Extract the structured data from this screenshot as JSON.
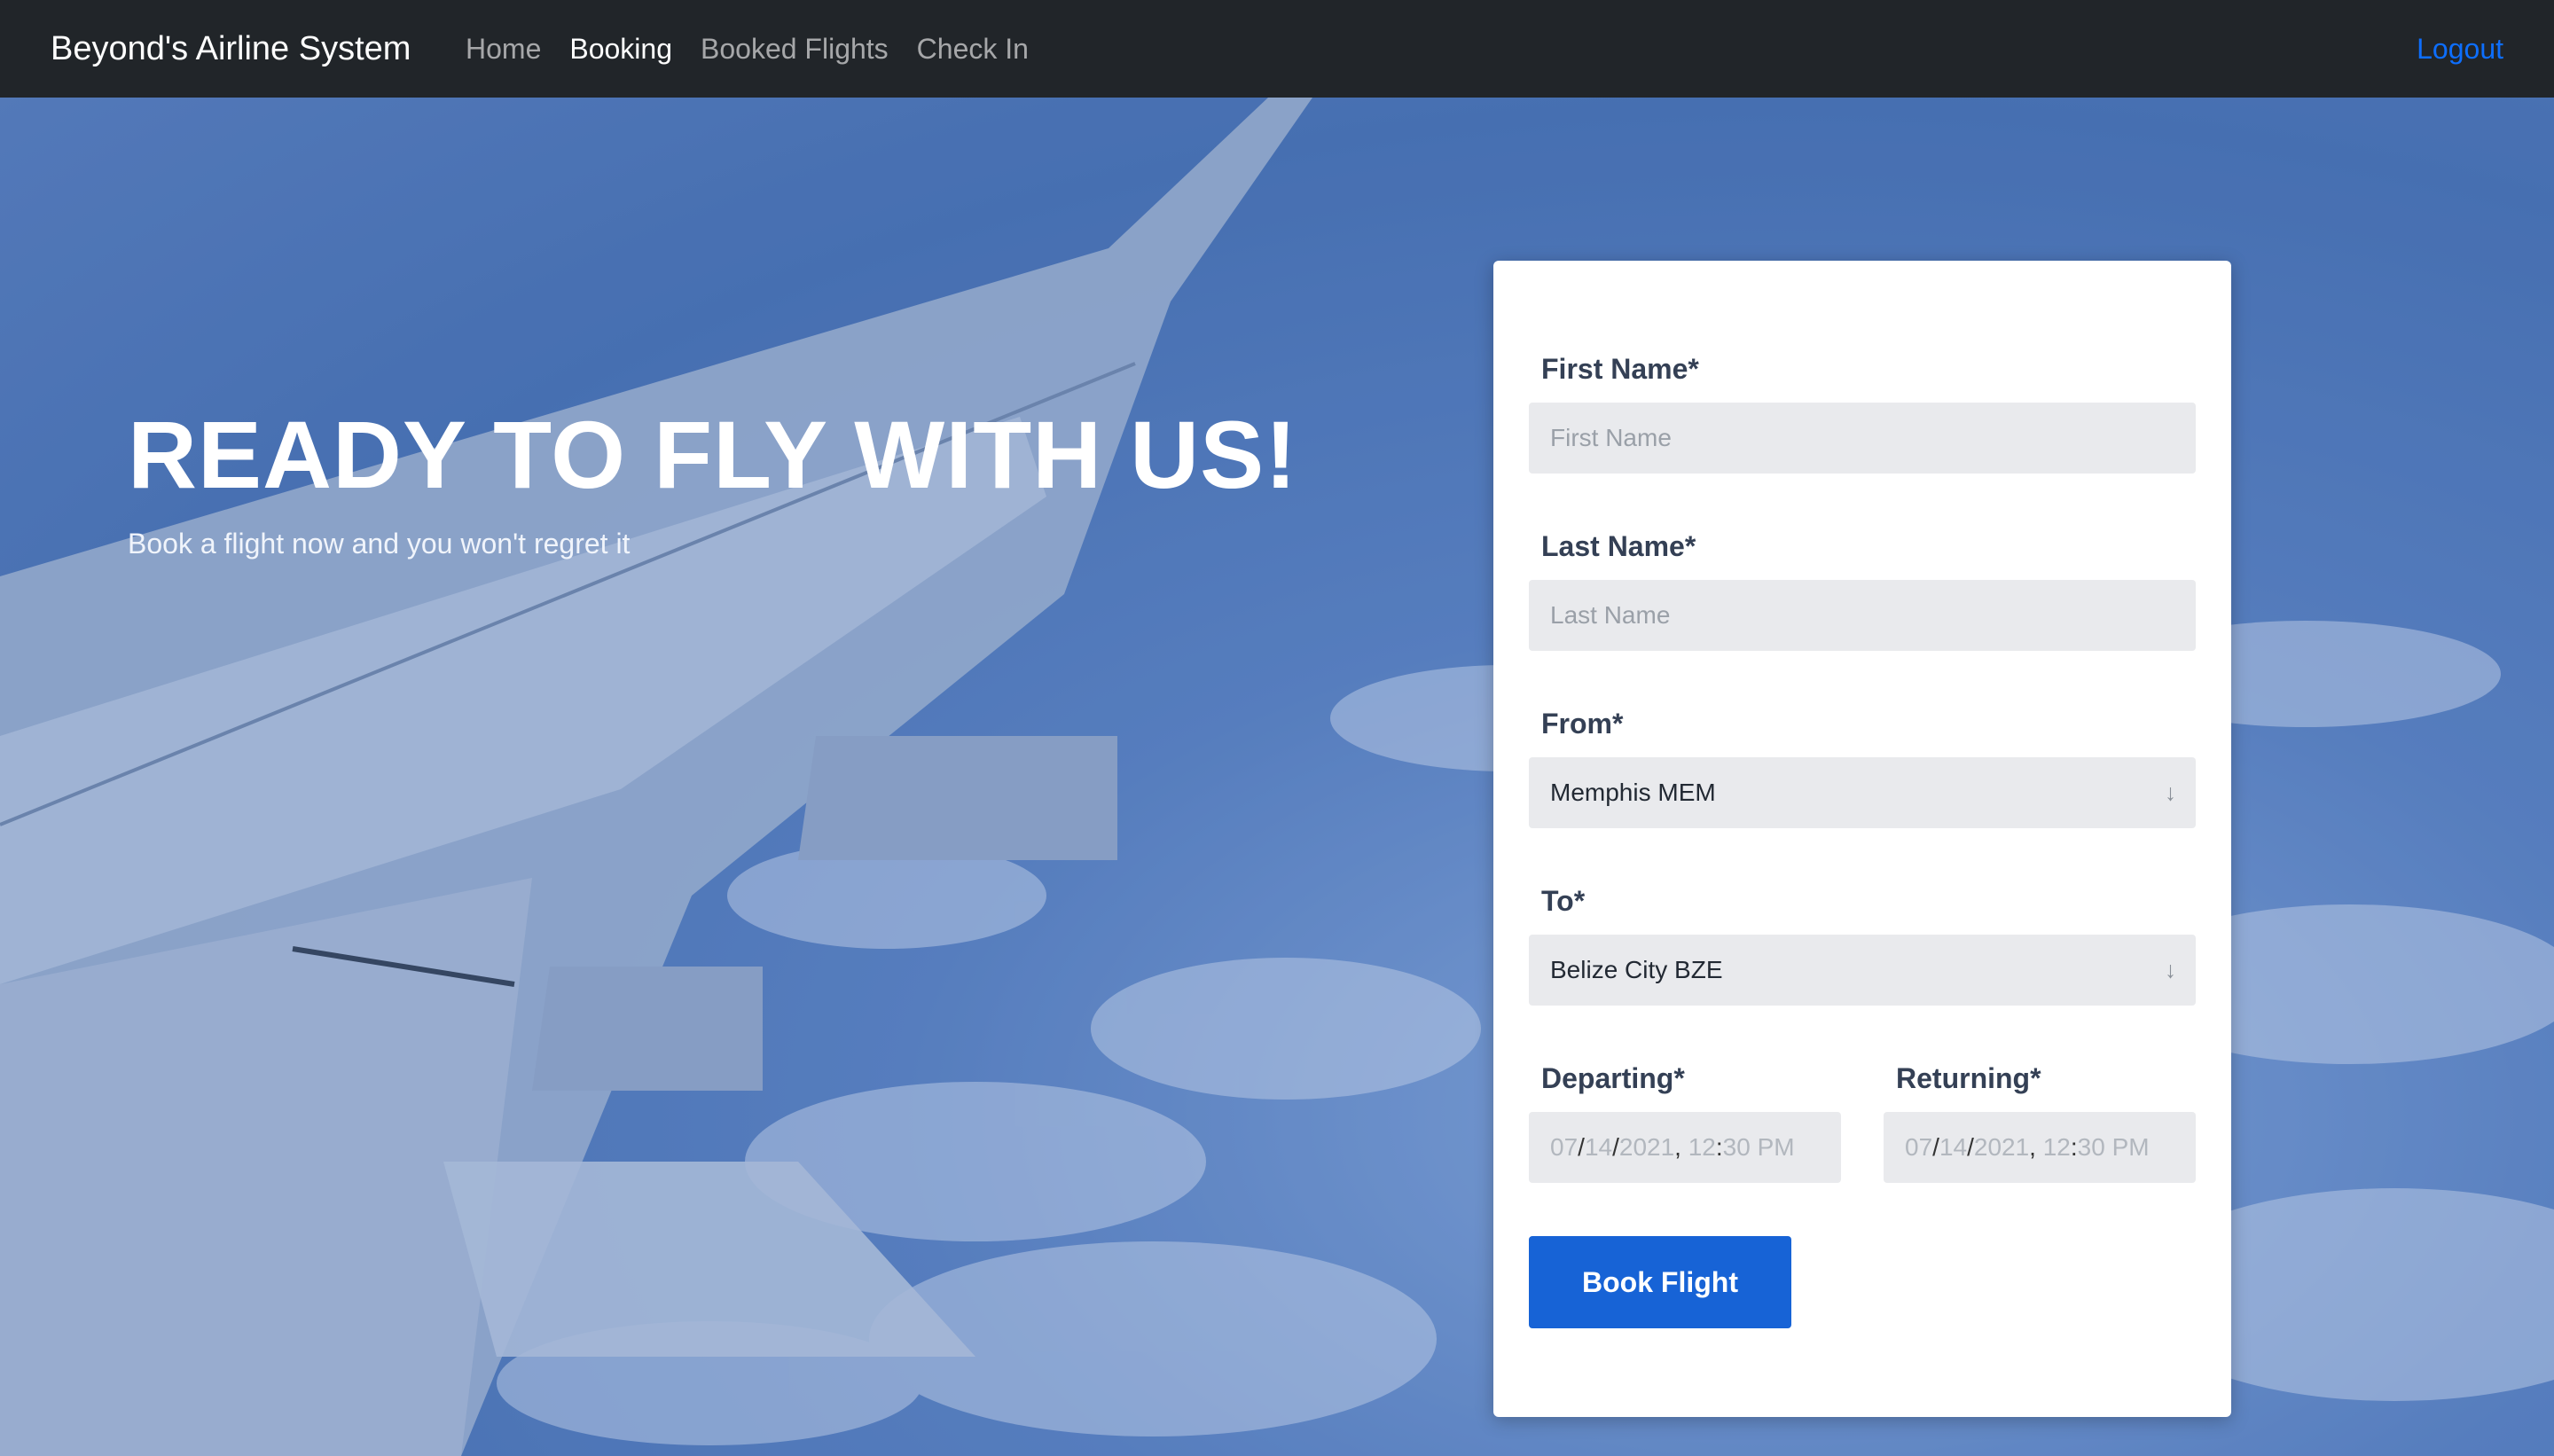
{
  "nav": {
    "brand": "Beyond's Airline System",
    "links": [
      "Home",
      "Booking",
      "Booked Flights",
      "Check In"
    ],
    "active": "Booking",
    "logout": "Logout"
  },
  "hero": {
    "headline": "READY TO FLY WITH US!",
    "subhead": "Book a flight now and you won't regret it"
  },
  "form": {
    "first_name": {
      "label": "First Name*",
      "placeholder": "First Name"
    },
    "last_name": {
      "label": "Last Name*",
      "placeholder": "Last Name"
    },
    "from": {
      "label": "From*",
      "value": "Memphis MEM"
    },
    "to": {
      "label": "To*",
      "value": "Belize City BZE"
    },
    "departing": {
      "label": "Departing*",
      "month": "07",
      "day": "14",
      "year": "2021",
      "hour": "12",
      "minute": "30",
      "ampm": "PM"
    },
    "returning": {
      "label": "Returning*",
      "month": "07",
      "day": "14",
      "year": "2021",
      "hour": "12",
      "minute": "30",
      "ampm": "PM"
    },
    "submit": "Book Flight"
  },
  "colors": {
    "navbar": "#212529",
    "accent": "#1763d6",
    "logout": "#0d6efd"
  }
}
